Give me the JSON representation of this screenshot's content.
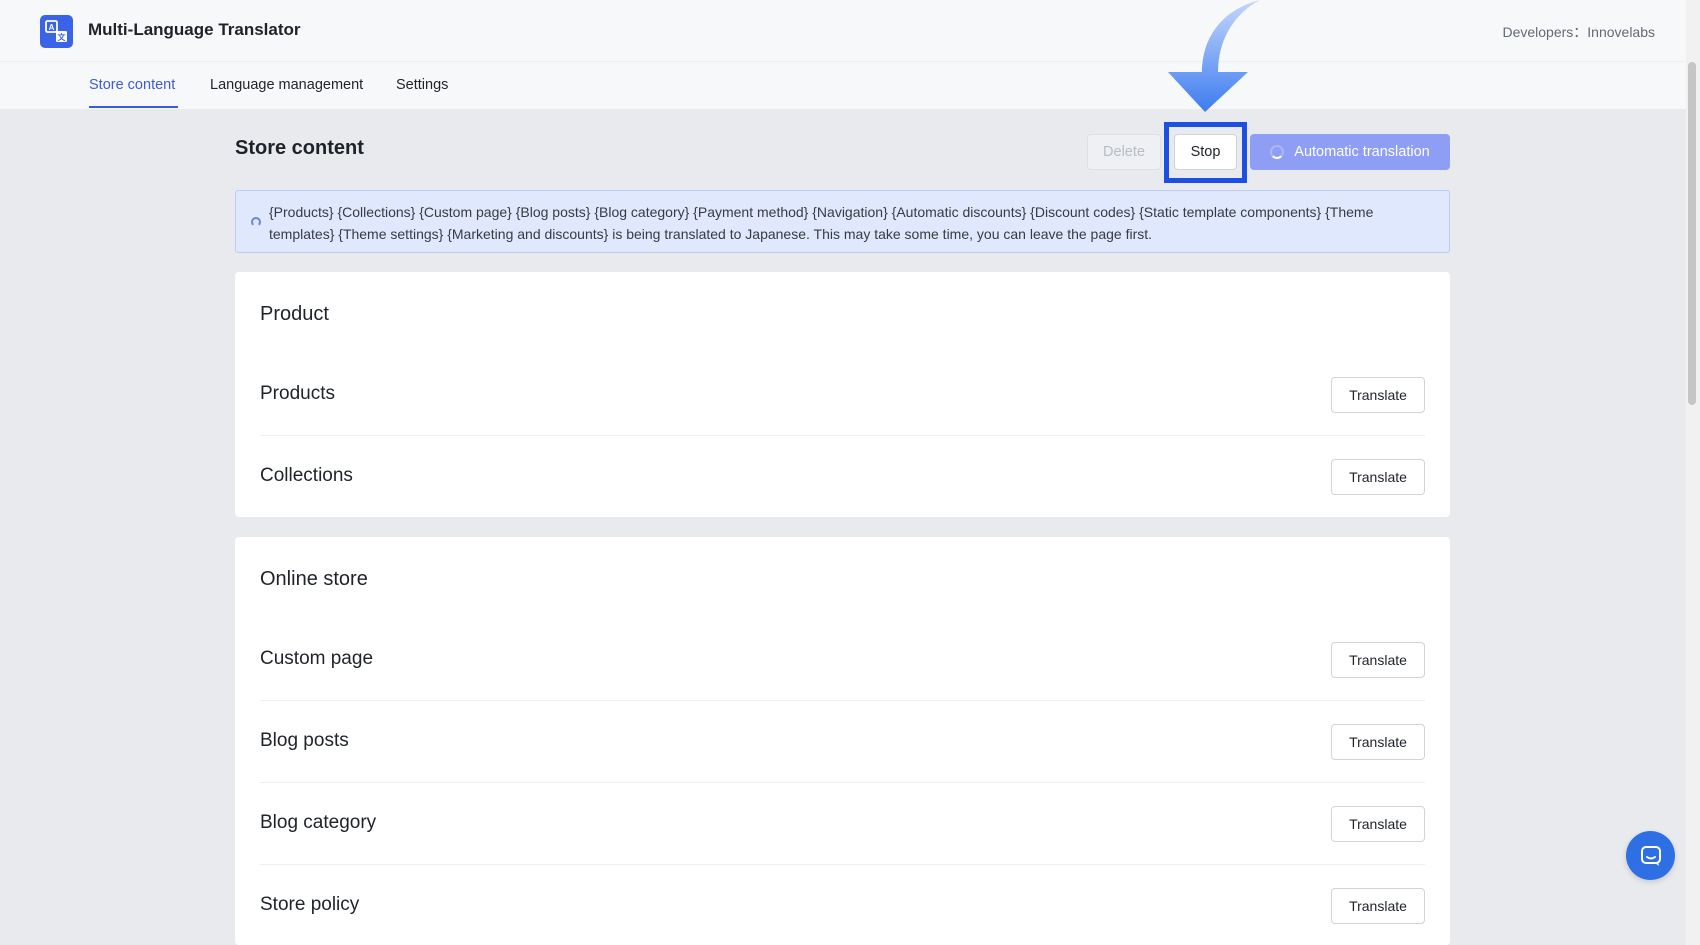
{
  "app": {
    "title": "Multi-Language Translator",
    "developer_credit": "Developers：Innovelabs",
    "logo_icon": "translate-icon"
  },
  "tabs": [
    {
      "label": "Store content",
      "active": true
    },
    {
      "label": "Language management",
      "active": false
    },
    {
      "label": "Settings",
      "active": false
    }
  ],
  "page": {
    "heading": "Store content",
    "actions": {
      "delete_label": "Delete",
      "stop_label": "Stop",
      "auto_translate_label": "Automatic translation"
    }
  },
  "banner": {
    "message": "{Products} {Collections} {Custom page} {Blog posts} {Blog category} {Payment method} {Navigation} {Automatic discounts} {Discount codes} {Static template components} {Theme templates} {Theme settings} {Marketing and discounts} is being translated to Japanese. This may take some time, you can leave the page first."
  },
  "sections": [
    {
      "title": "Product",
      "items": [
        {
          "label": "Products",
          "button": "Translate"
        },
        {
          "label": "Collections",
          "button": "Translate"
        }
      ]
    },
    {
      "title": "Online store",
      "items": [
        {
          "label": "Custom page",
          "button": "Translate"
        },
        {
          "label": "Blog posts",
          "button": "Translate"
        },
        {
          "label": "Blog category",
          "button": "Translate"
        },
        {
          "label": "Store policy",
          "button": "Translate"
        }
      ]
    }
  ],
  "colors": {
    "accent": "#3b5bdb",
    "primary_button": "#8f9ef5",
    "highlight_box": "#1d4fe0",
    "banner_bg": "#dfe8fc"
  },
  "icons": {
    "chat": "chat-icon",
    "pointer_arrow": "pointer-arrow-icon"
  }
}
